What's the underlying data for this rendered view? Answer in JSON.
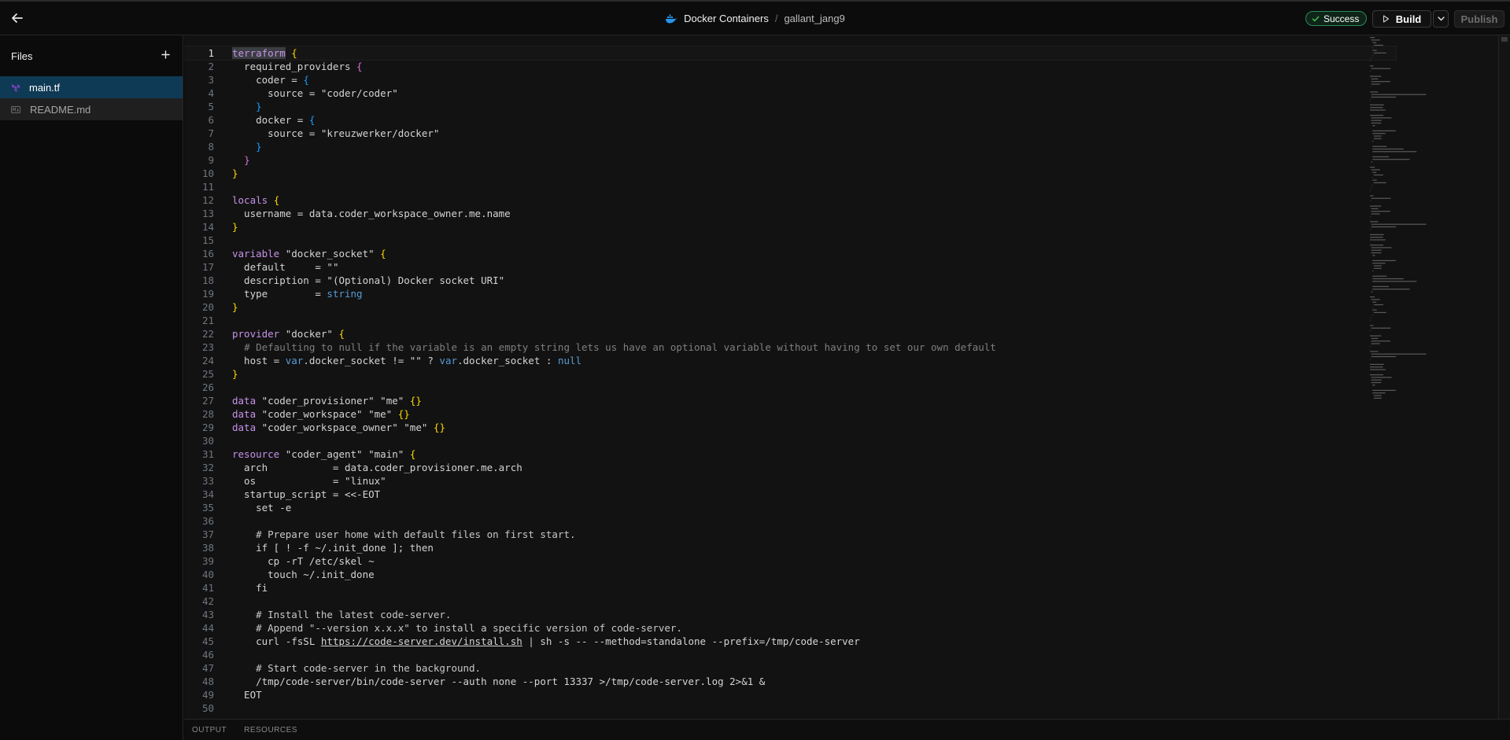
{
  "header": {
    "template_name": "Docker Containers",
    "separator": "/",
    "version_name": "gallant_jang9",
    "status": "Success",
    "build_label": "Build",
    "publish_label": "Publish"
  },
  "sidebar": {
    "title": "Files",
    "files": [
      {
        "name": "main.tf",
        "active": true
      },
      {
        "name": "README.md",
        "active": false
      }
    ]
  },
  "editor": {
    "line_numbers": [
      "1",
      "2",
      "3",
      "4",
      "5",
      "6",
      "7",
      "8",
      "9",
      "10",
      "11",
      "12",
      "13",
      "14",
      "15",
      "16",
      "17",
      "18",
      "19",
      "20",
      "21",
      "22",
      "23",
      "24",
      "25",
      "26",
      "27",
      "28",
      "29",
      "30",
      "31",
      "32",
      "33",
      "34",
      "35",
      "36",
      "37",
      "38",
      "39",
      "40",
      "41",
      "42",
      "43",
      "44",
      "45",
      "46",
      "47",
      "48",
      "49",
      "50"
    ],
    "lines": [
      "terraform {",
      "  required_providers {",
      "    coder = {",
      "      source = \"coder/coder\"",
      "    }",
      "    docker = {",
      "      source = \"kreuzwerker/docker\"",
      "    }",
      "  }",
      "}",
      "",
      "locals {",
      "  username = data.coder_workspace_owner.me.name",
      "}",
      "",
      "variable \"docker_socket\" {",
      "  default     = \"\"",
      "  description = \"(Optional) Docker socket URI\"",
      "  type        = string",
      "}",
      "",
      "provider \"docker\" {",
      "  # Defaulting to null if the variable is an empty string lets us have an optional variable without having to set our own default",
      "  host = var.docker_socket != \"\" ? var.docker_socket : null",
      "}",
      "",
      "data \"coder_provisioner\" \"me\" {}",
      "data \"coder_workspace\" \"me\" {}",
      "data \"coder_workspace_owner\" \"me\" {}",
      "",
      "resource \"coder_agent\" \"main\" {",
      "  arch           = data.coder_provisioner.me.arch",
      "  os             = \"linux\"",
      "  startup_script = <<-EOT",
      "    set -e",
      "",
      "    # Prepare user home with default files on first start.",
      "    if [ ! -f ~/.init_done ]; then",
      "      cp -rT /etc/skel ~",
      "      touch ~/.init_done",
      "    fi",
      "",
      "    # Install the latest code-server.",
      "    # Append \"--version x.x.x\" to install a specific version of code-server.",
      "    curl -fsSL https://code-server.dev/install.sh | sh -s -- --method=standalone --prefix=/tmp/code-server",
      "",
      "    # Start code-server in the background.",
      "    /tmp/code-server/bin/code-server --auth none --port 13337 >/tmp/code-server.log 2>&1 &",
      "  EOT",
      ""
    ]
  },
  "bottom_panel": {
    "tabs": [
      "OUTPUT",
      "RESOURCES"
    ]
  },
  "colors": {
    "success": "#2e8b57",
    "active_file": "#0f3a55",
    "keyword": "#c586c0",
    "string": "#ce9178",
    "type": "#569cd6"
  },
  "icons": {
    "back": "arrow-left-icon",
    "template": "docker-whale-icon",
    "status": "check-icon",
    "build": "play-icon",
    "build_menu": "chevron-down-icon",
    "add_file": "plus-icon",
    "tf_file": "terraform-icon",
    "md_file": "markdown-icon"
  }
}
